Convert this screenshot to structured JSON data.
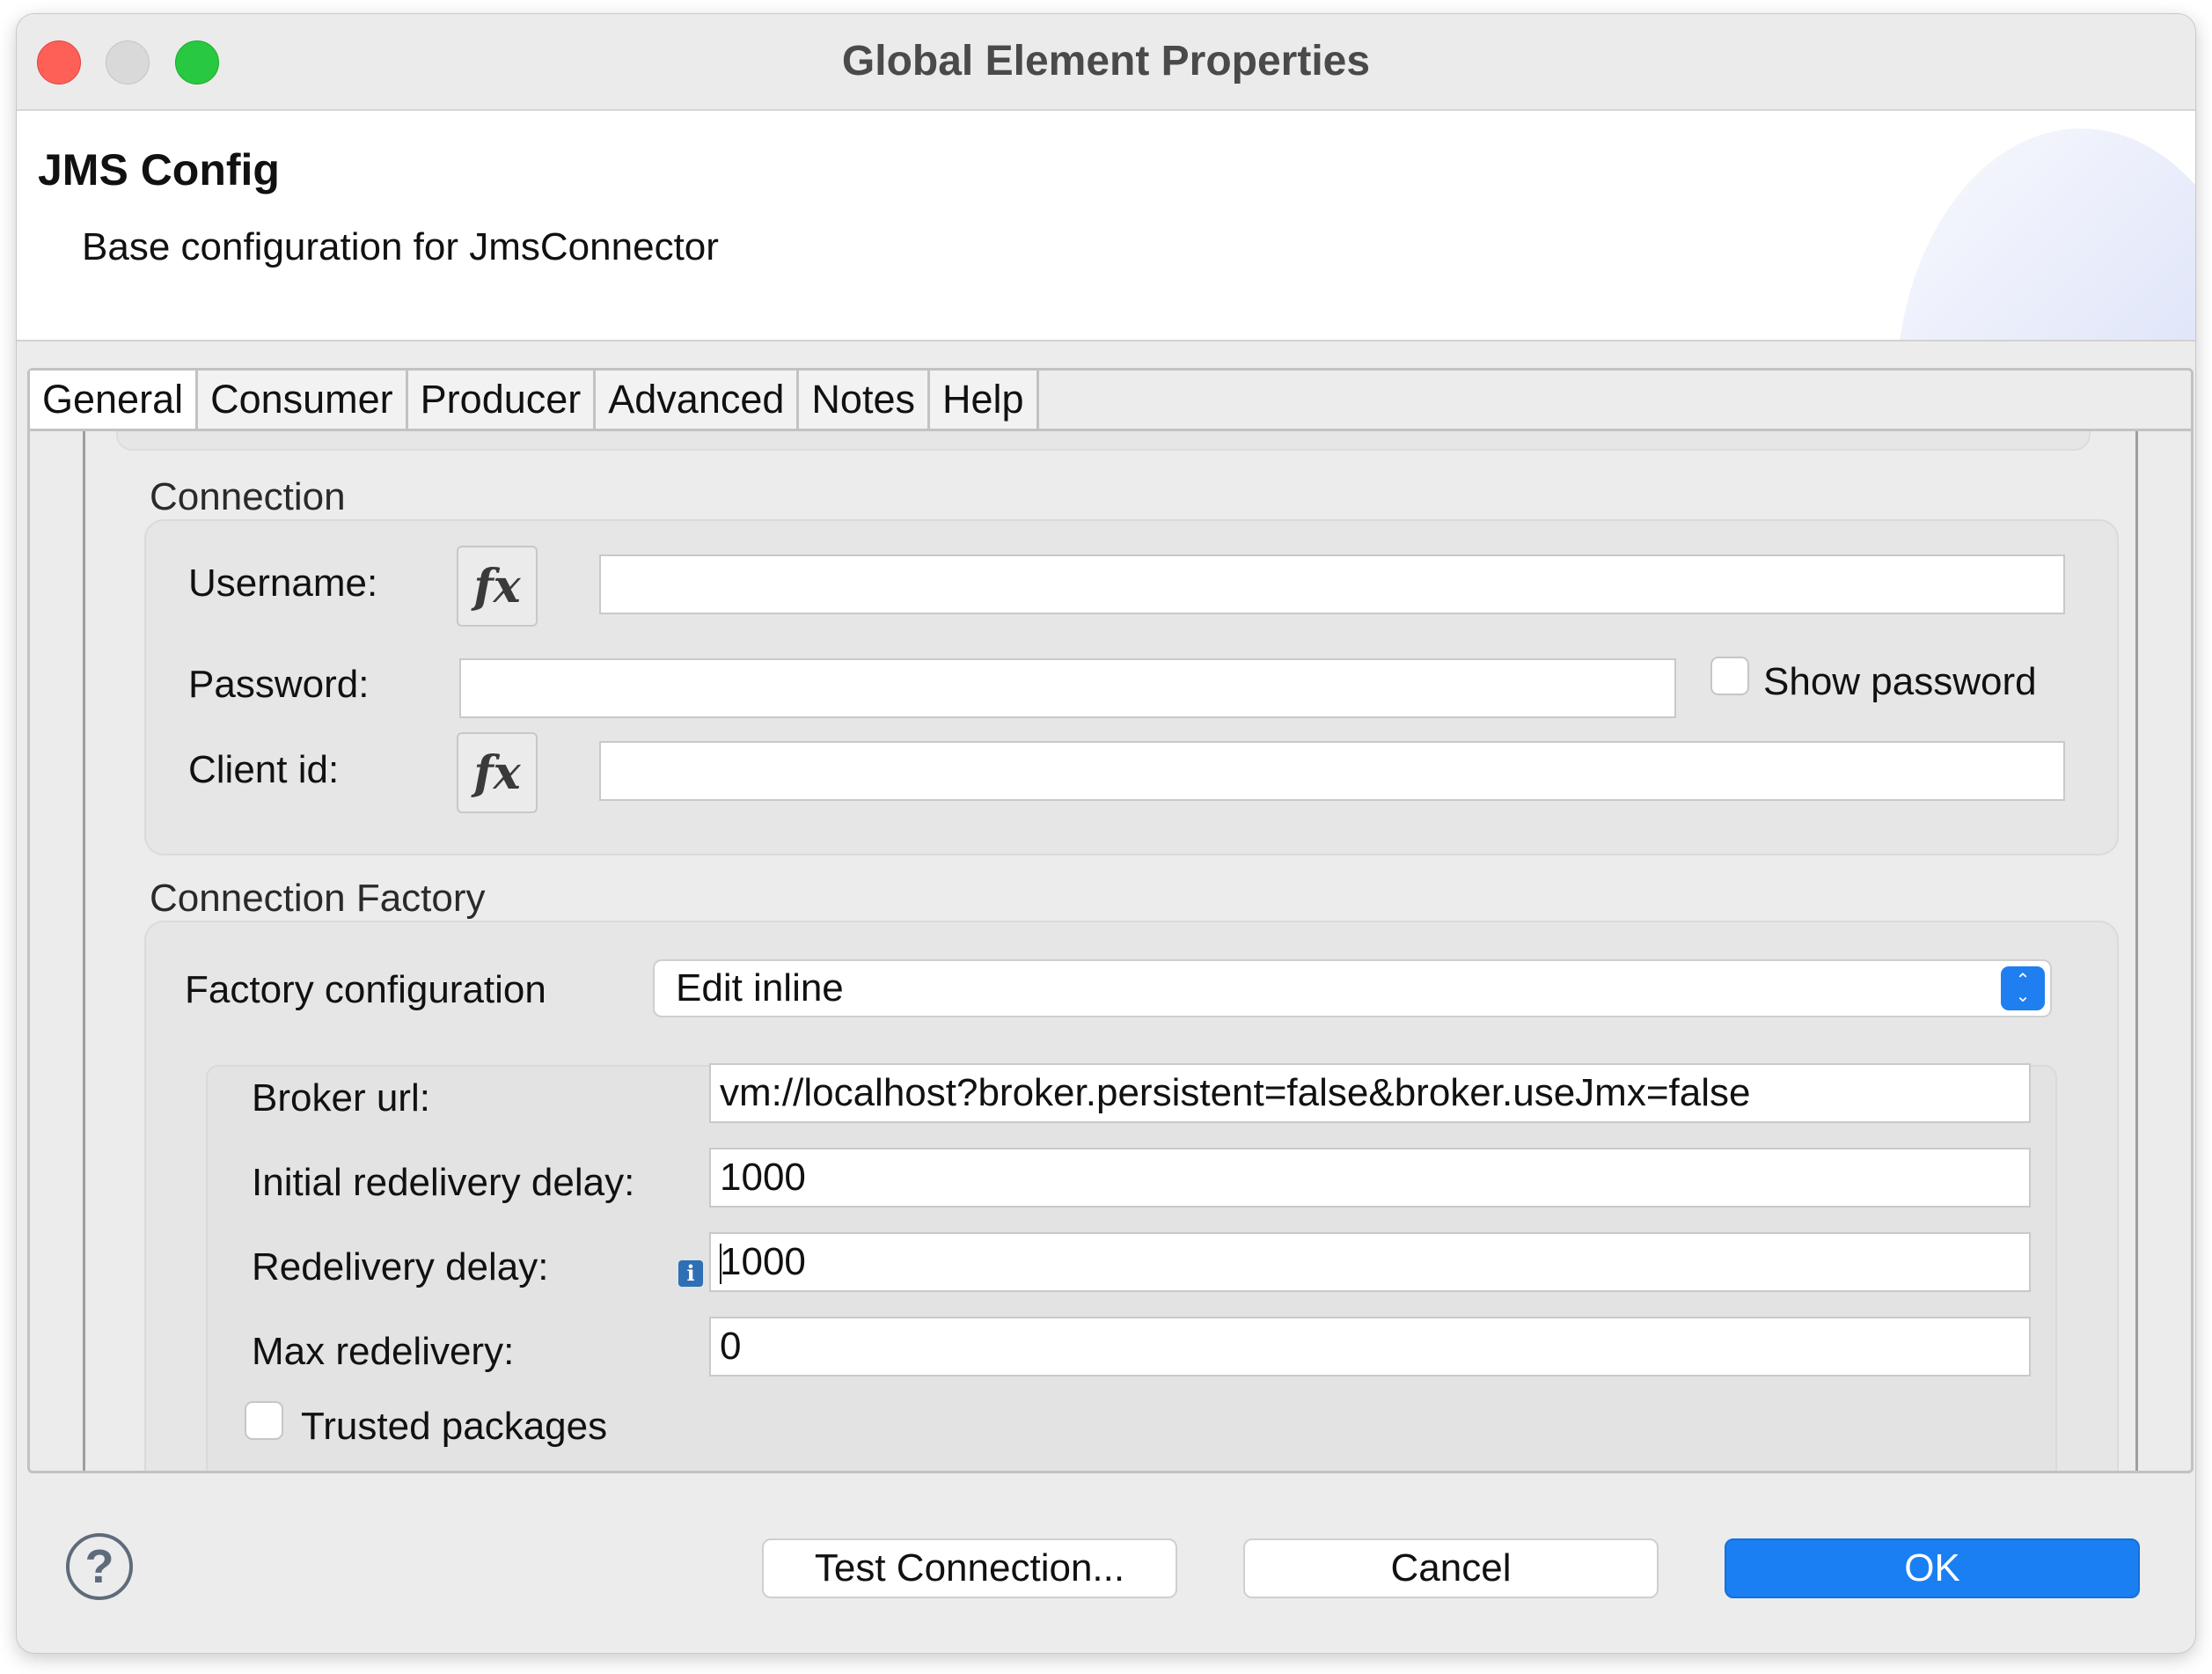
{
  "window": {
    "title": "Global Element Properties"
  },
  "header": {
    "title": "JMS Config",
    "description": "Base configuration for JmsConnector"
  },
  "tabs": [
    {
      "label": "General",
      "active": true
    },
    {
      "label": "Consumer",
      "active": false
    },
    {
      "label": "Producer",
      "active": false
    },
    {
      "label": "Advanced",
      "active": false
    },
    {
      "label": "Notes",
      "active": false
    },
    {
      "label": "Help",
      "active": false
    }
  ],
  "connection": {
    "group_label": "Connection",
    "username_label": "Username:",
    "username_value": "",
    "password_label": "Password:",
    "password_value": "",
    "show_password_label": "Show password",
    "show_password_checked": false,
    "client_id_label": "Client id:",
    "client_id_value": "",
    "fx_icon": "fx"
  },
  "connection_factory": {
    "group_label": "Connection Factory",
    "factory_config_label": "Factory configuration",
    "factory_config_value": "Edit inline",
    "broker_url_label": "Broker url:",
    "broker_url_value": "vm://localhost?broker.persistent=false&broker.useJmx=false",
    "initial_redelivery_delay_label": "Initial redelivery delay:",
    "initial_redelivery_delay_value": "1000",
    "redelivery_delay_label": "Redelivery delay:",
    "redelivery_delay_value": "1000",
    "max_redelivery_label": "Max redelivery:",
    "max_redelivery_value": "0",
    "trusted_packages_label": "Trusted packages",
    "trusted_packages_checked": false,
    "info_icon": "i"
  },
  "footer": {
    "help_icon": "?",
    "test_connection_label": "Test Connection...",
    "cancel_label": "Cancel",
    "ok_label": "OK"
  },
  "colors": {
    "primary": "#1a7ff2",
    "close": "#fe5f57",
    "zoom": "#28c840",
    "info": "#2f6fb6"
  }
}
